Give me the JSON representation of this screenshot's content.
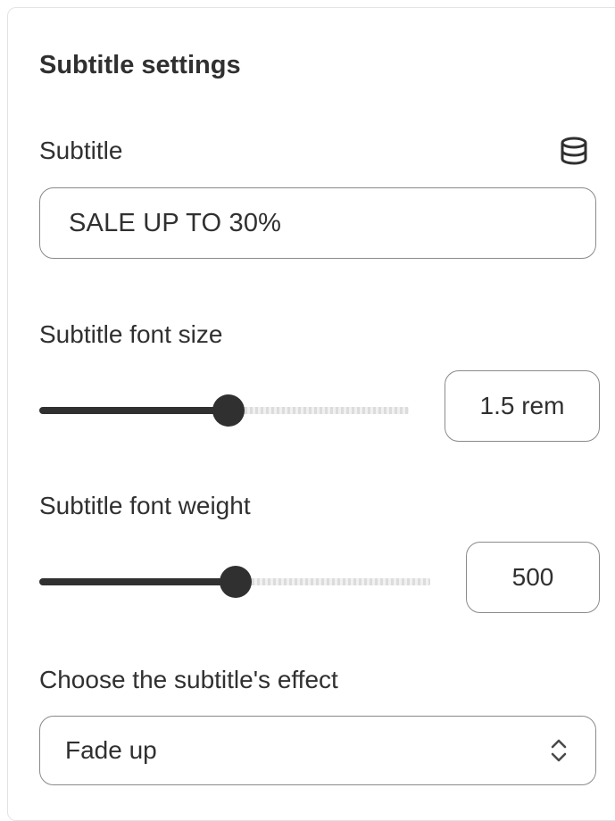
{
  "section": {
    "title": "Subtitle settings"
  },
  "subtitle": {
    "label": "Subtitle",
    "value": "SALE UP TO 30%",
    "source_icon": "database-icon"
  },
  "font_size": {
    "label": "Subtitle font size",
    "value": "1.5 rem",
    "slider_fraction": 0.5
  },
  "font_weight": {
    "label": "Subtitle font weight",
    "value": "500",
    "slider_fraction": 0.5
  },
  "effect": {
    "label": "Choose the subtitle's effect",
    "selected": "Fade up",
    "chevron_icon": "select-chevron-icon"
  },
  "colors": {
    "text": "#303030",
    "border": "#8a8a8a",
    "track_filled": "#303030",
    "track_empty": "#dcdcdc"
  }
}
